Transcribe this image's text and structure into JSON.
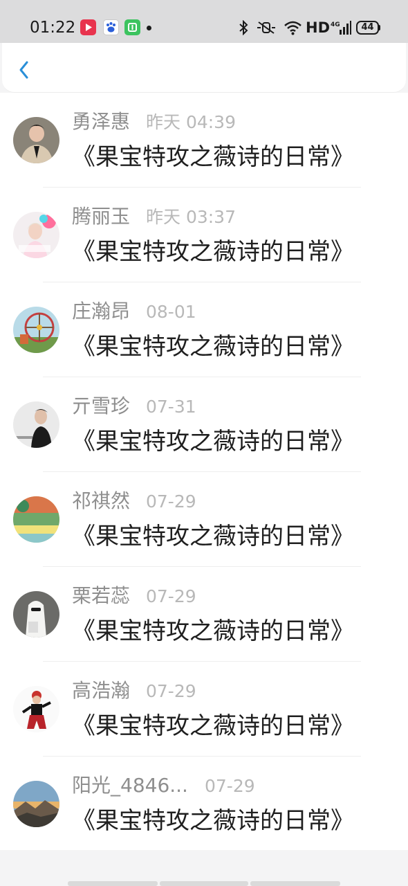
{
  "status_bar": {
    "time": "01:22",
    "network": "HD",
    "signal_label": "4G",
    "battery": "44",
    "icons": [
      "video-app-icon",
      "baidu-app-icon",
      "green-app-icon",
      "bluetooth-icon",
      "mute-icon",
      "wifi-icon",
      "signal-icon",
      "battery-icon"
    ]
  },
  "header": {
    "back_icon": "chevron-left-icon"
  },
  "colors": {
    "accent": "#2a8fd8",
    "name": "#8e8e8e",
    "time": "#b8b8b8",
    "title": "#1f1f1f"
  },
  "items": [
    {
      "name": "勇泽惠",
      "time": "昨天 04:39",
      "title": "《果宝特攻之薇诗的日常》"
    },
    {
      "name": "腾丽玉",
      "time": "昨天 03:37",
      "title": "《果宝特攻之薇诗的日常》"
    },
    {
      "name": "庄瀚昂",
      "time": "08-01",
      "title": "《果宝特攻之薇诗的日常》"
    },
    {
      "name": "亓雪珍",
      "time": "07-31",
      "title": "《果宝特攻之薇诗的日常》"
    },
    {
      "name": "祁祺然",
      "time": "07-29",
      "title": "《果宝特攻之薇诗的日常》"
    },
    {
      "name": "栗若蕊",
      "time": "07-29",
      "title": "《果宝特攻之薇诗的日常》"
    },
    {
      "name": "高浩瀚",
      "time": "07-29",
      "title": "《果宝特攻之薇诗的日常》"
    },
    {
      "name": "阳光_4846...",
      "time": "07-29",
      "title": "《果宝特攻之薇诗的日常》"
    }
  ]
}
